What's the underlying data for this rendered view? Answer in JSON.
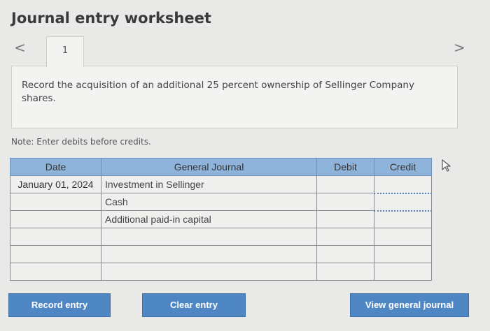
{
  "title": "Journal entry worksheet",
  "nav": {
    "prev": "<",
    "next": ">"
  },
  "tabs": [
    {
      "label": "1"
    }
  ],
  "prompt": "Record the acquisition of an additional 25 percent ownership of Sellinger Company shares.",
  "note": "Note: Enter debits before credits.",
  "table": {
    "headers": {
      "date": "Date",
      "journal": "General Journal",
      "debit": "Debit",
      "credit": "Credit"
    },
    "rows": [
      {
        "date": "January 01, 2024",
        "account": "Investment in Sellinger",
        "debit": "",
        "credit": ""
      },
      {
        "date": "",
        "account": "Cash",
        "debit": "",
        "credit": ""
      },
      {
        "date": "",
        "account": "Additional paid-in capital",
        "debit": "",
        "credit": ""
      },
      {
        "date": "",
        "account": "",
        "debit": "",
        "credit": ""
      },
      {
        "date": "",
        "account": "",
        "debit": "",
        "credit": ""
      },
      {
        "date": "",
        "account": "",
        "debit": "",
        "credit": ""
      }
    ]
  },
  "buttons": {
    "record": "Record entry",
    "clear": "Clear entry",
    "view": "View general journal"
  },
  "colors": {
    "header": "#8fb4dc",
    "button": "#4f87c4",
    "border_accent": "#5a82b4"
  }
}
